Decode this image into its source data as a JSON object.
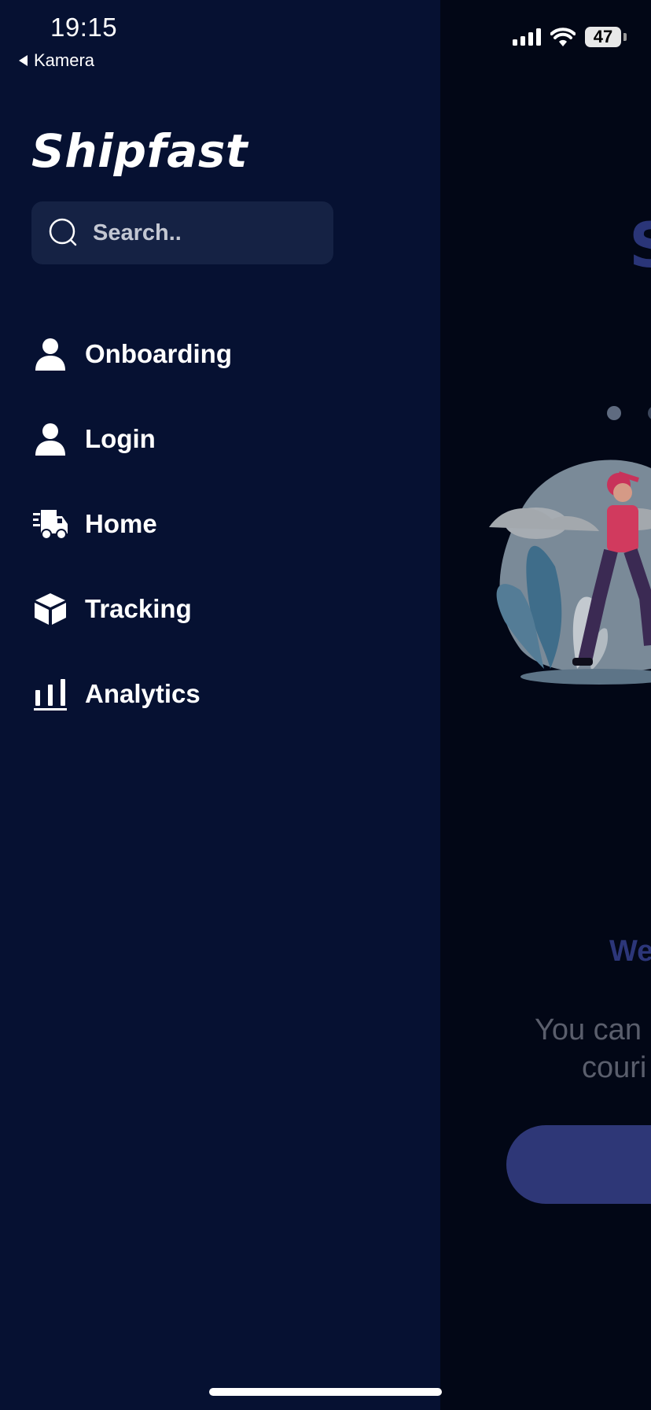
{
  "status_bar": {
    "time": "19:15",
    "back_app": "Kamera",
    "battery": "47"
  },
  "drawer": {
    "brand": "Shipfast",
    "search": {
      "placeholder": "Search.."
    },
    "nav_items": [
      {
        "label": "Onboarding",
        "icon": "user-icon"
      },
      {
        "label": "Login",
        "icon": "user-icon"
      },
      {
        "label": "Home",
        "icon": "delivery-truck-icon"
      },
      {
        "label": "Tracking",
        "icon": "box-icon"
      },
      {
        "label": "Analytics",
        "icon": "bar-chart-icon"
      }
    ]
  },
  "background_screen": {
    "title_partial": "S",
    "welcome_partial": "We",
    "description_line1_partial": "You can",
    "description_line2_partial": "couri"
  },
  "colors": {
    "drawer_bg": "#061132",
    "search_bg": "#152244",
    "background_app": "#020716",
    "accent_dimmed": "#2e3777"
  }
}
